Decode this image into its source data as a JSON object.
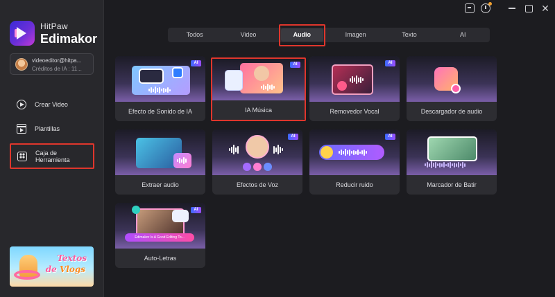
{
  "window": {
    "controls": [
      "message-icon",
      "update-icon",
      "minimize-icon",
      "maximize-icon",
      "close-icon"
    ],
    "close_glyph": "✕"
  },
  "brand": {
    "line1": "HitPaw",
    "line2": "Edimakor"
  },
  "account": {
    "email": "videoeditor@hitpa...",
    "credits": "Créditos de IA : 11..."
  },
  "sidebar": {
    "items": [
      {
        "label": "Crear Video",
        "icon": "play-circle-icon"
      },
      {
        "label": "Plantillas",
        "icon": "template-icon"
      },
      {
        "label": "Caja de Herramienta",
        "icon": "toolbox-icon",
        "selected": true
      }
    ],
    "promo": {
      "line1": "Textos",
      "line2_a": "de ",
      "line2_b": "Vlogs"
    }
  },
  "tabs": [
    {
      "label": "Todos"
    },
    {
      "label": "Video"
    },
    {
      "label": "Audio",
      "active": true
    },
    {
      "label": "Imagen"
    },
    {
      "label": "Texto"
    },
    {
      "label": "AI"
    }
  ],
  "cards": [
    {
      "label": "Efecto de Sonido de IA",
      "badge": "AI"
    },
    {
      "label": "IA Música",
      "badge": "AI",
      "highlighted": true
    },
    {
      "label": "Removedor Vocal",
      "badge": "AI"
    },
    {
      "label": "Descargador de audio"
    },
    {
      "label": "Extraer audio"
    },
    {
      "label": "Efectos de Voz",
      "badge": "AI"
    },
    {
      "label": "Reducir ruido",
      "badge": "AI"
    },
    {
      "label": "Marcador de Batir"
    },
    {
      "label": "Auto-Letras",
      "badge": "AI",
      "caption": "Edimakor Is A Good Editing To..."
    }
  ],
  "colors": {
    "highlight": "#e0362c",
    "accent_ai": "#6b4dff",
    "sidebar_bg": "#28282c",
    "main_bg": "#1c1c20"
  }
}
